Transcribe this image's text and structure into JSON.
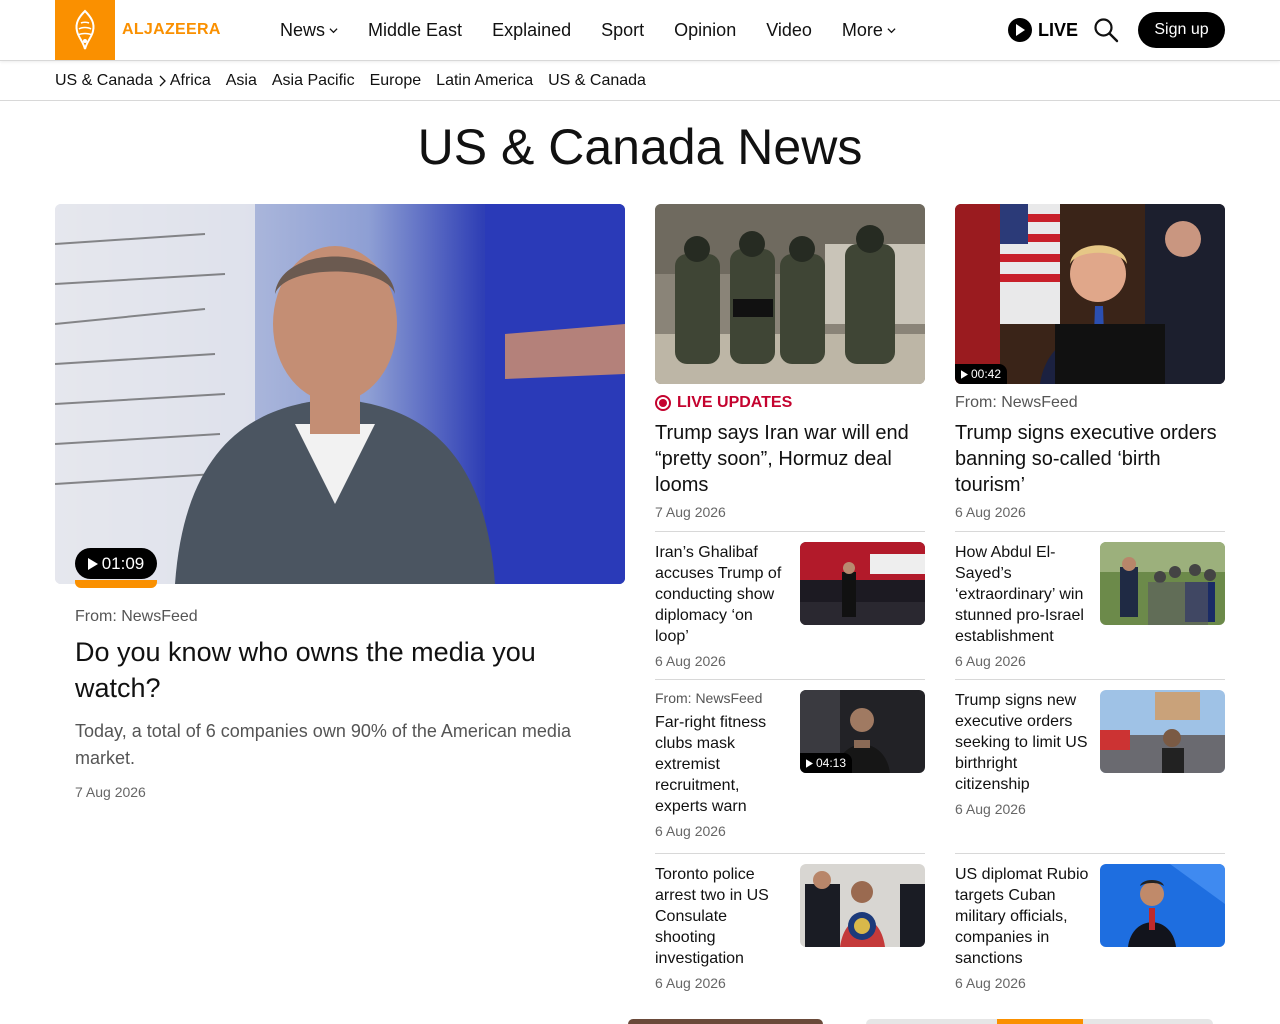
{
  "header": {
    "logo_text": "ALJAZEERA",
    "nav": [
      {
        "label": "News",
        "has_dropdown": true
      },
      {
        "label": "Middle East",
        "has_dropdown": false
      },
      {
        "label": "Explained",
        "has_dropdown": false
      },
      {
        "label": "Sport",
        "has_dropdown": false
      },
      {
        "label": "Opinion",
        "has_dropdown": false
      },
      {
        "label": "Video",
        "has_dropdown": false
      },
      {
        "label": "More",
        "has_dropdown": true
      }
    ],
    "live_label": "LIVE",
    "signup_label": "Sign up"
  },
  "subnav": {
    "current": "US & Canada",
    "links": [
      "Africa",
      "Asia",
      "Asia Pacific",
      "Europe",
      "Latin America",
      "US & Canada"
    ]
  },
  "page_title": "US & Canada News",
  "feature": {
    "duration": "01:09",
    "source": "From: NewsFeed",
    "title": "Do you know who owns the media you watch?",
    "summary": "Today, a total of 6 companies own 90% of the American media market.",
    "date": "7 Aug 2026"
  },
  "top_cards": [
    {
      "label": "LIVE UPDATES",
      "title": "Trump says Iran war will end “pretty soon”, Hormuz deal looms",
      "date": "7 Aug 2026"
    },
    {
      "duration": "00:42",
      "source": "From: NewsFeed",
      "title": "Trump signs executive orders banning so-called ‘birth tourism’",
      "date": "6 Aug 2026"
    }
  ],
  "items": [
    {
      "title": "Iran’s Ghalibaf accuses Trump of conducting show diplomacy ‘on loop’",
      "date": "6 Aug 2026"
    },
    {
      "title": "How Abdul El-Sayed’s ‘extraordinary’ win stunned pro-Israel establishment",
      "date": "6 Aug 2026"
    },
    {
      "source": "From: NewsFeed",
      "title": "Far-right fitness clubs mask extremist recruitment, experts warn",
      "date": "6 Aug 2026",
      "duration": "04:13"
    },
    {
      "title": "Trump signs new executive orders seeking to limit US birthright citizenship",
      "date": "6 Aug 2026"
    },
    {
      "title": "Toronto police arrest two in US Consulate shooting investigation",
      "date": "6 Aug 2026"
    },
    {
      "title": "US diplomat Rubio targets Cuban military officials, companies in sanctions",
      "date": "6 Aug 2026"
    }
  ],
  "colors": {
    "brand": "#fa9000",
    "live": "#c4032f"
  }
}
